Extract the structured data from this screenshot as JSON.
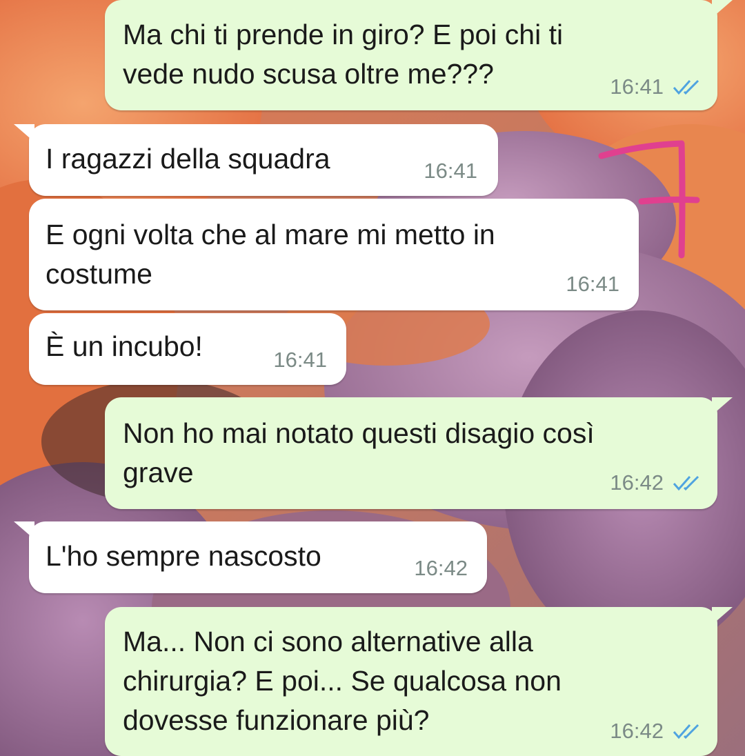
{
  "chat": {
    "messages": [
      {
        "direction": "outgoing",
        "text": "Ma chi ti prende in giro? E poi chi ti\nvede nudo scusa oltre me???",
        "time": "16:41",
        "status": "read"
      },
      {
        "direction": "incoming",
        "text": "I ragazzi della squadra",
        "time": "16:41"
      },
      {
        "direction": "incoming",
        "text": "E ogni volta che al mare mi metto in\ncostume",
        "time": "16:41"
      },
      {
        "direction": "incoming",
        "text": "È un incubo!",
        "time": "16:41"
      },
      {
        "direction": "outgoing",
        "text": "Non ho mai notato questi disagio così\ngrave",
        "time": "16:42",
        "status": "read"
      },
      {
        "direction": "incoming",
        "text": "L'ho sempre nascosto",
        "time": "16:42"
      },
      {
        "direction": "outgoing",
        "text": "Ma... Non ci sono alternative alla\nchirurgia? E poi... Se qualcosa non\ndovesse funzionare più?",
        "time": "16:42",
        "status": "read"
      }
    ]
  },
  "icons": {
    "read_receipt": "double-check-icon",
    "annotation": "handwritten-7-annotation"
  },
  "colors": {
    "outgoing_bubble": "#e6fbd7",
    "incoming_bubble": "#ffffff",
    "read_tick": "#4fa3e0",
    "time_text": "#7b8a86",
    "annotation_ink": "#e0408f"
  }
}
